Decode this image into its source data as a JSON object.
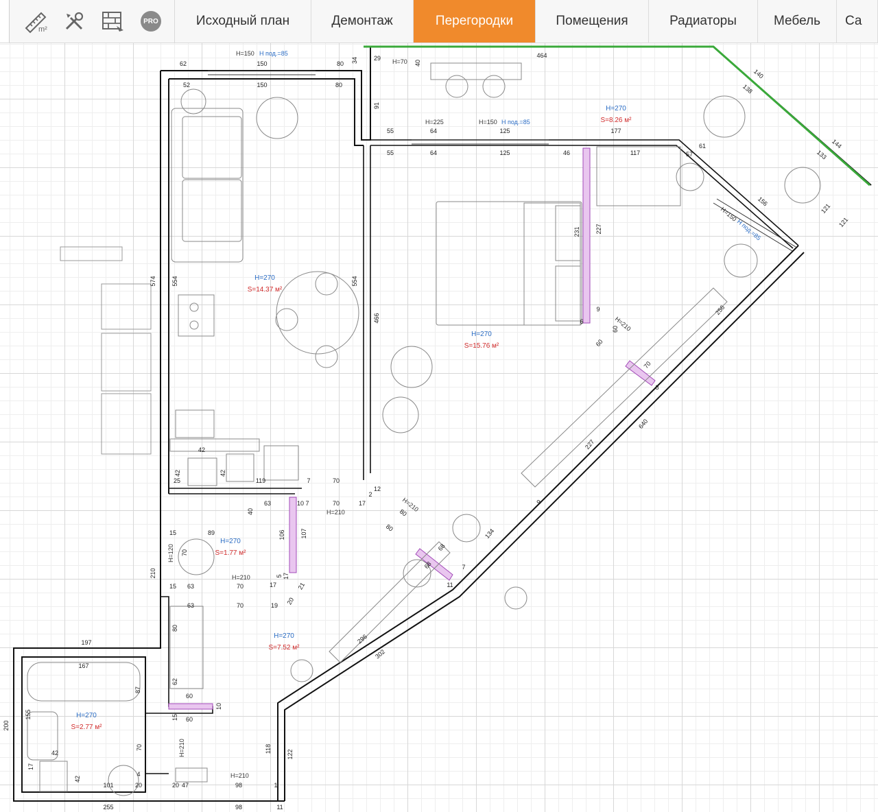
{
  "toolbar": {
    "icons": [
      "area-m2-icon",
      "tools-icon",
      "bricks-plan-icon",
      "pro-badge-icon"
    ],
    "pro_label": "PRO",
    "tabs": [
      {
        "label": "Исходный план",
        "active": false
      },
      {
        "label": "Демонтаж",
        "active": false
      },
      {
        "label": "Перегородки",
        "active": true
      },
      {
        "label": "Помещения",
        "active": false
      },
      {
        "label": "Радиаторы",
        "active": false
      },
      {
        "label": "Мебель",
        "active": false
      },
      {
        "label": "Са",
        "active": false
      }
    ],
    "accent_color": "#f08a2c"
  },
  "rooms": [
    {
      "height": "H=270",
      "area": "S=14.37 м²"
    },
    {
      "height": "H=270",
      "area": "S=15.76 м²"
    },
    {
      "height": "H=270",
      "area": "S=8.26 м²"
    },
    {
      "height": "H=270",
      "area": "S=1.77 м²"
    },
    {
      "height": "H=270",
      "area": "S=7.52 м²"
    },
    {
      "height": "H=270",
      "area": "S=2.77 м²"
    }
  ],
  "openings": {
    "window_top": "H=150",
    "sill_top": "Н под.=85",
    "h70": "H=70",
    "h225": "H=225",
    "window_mid": "H=150",
    "sill_mid": "Н под.=85",
    "window_diag": "H=150",
    "sill_diag": "Н под.=85",
    "door_h210": "H=210",
    "door_h120": "H=120"
  },
  "dimensions": {
    "top_a": "62",
    "top_b": "150",
    "top_c": "80",
    "top_d": "34",
    "in_a": "52",
    "in_b": "150",
    "in_c": "80",
    "balc_a": "29",
    "balc_b": "40",
    "balc_c": "464",
    "balc_d": "91",
    "balc_e": "55",
    "balc_f": "64",
    "balc_g": "125",
    "balc_h": "177",
    "bed_a": "55",
    "bed_b": "64",
    "bed_c": "125",
    "bed_d": "46",
    "bal2_a": "117",
    "bal2_b": "61",
    "bal2_c": "57",
    "bal2_d": "140",
    "bal2_e": "138",
    "bal2_f": "144",
    "bal2_g": "133",
    "bal2_h": "156",
    "bal2_i": "121",
    "bal2_j": "121",
    "left_574": "574",
    "k_554": "554",
    "k_554b": "554",
    "bed_466": "466",
    "bed_231": "231",
    "bed_227": "227",
    "d_256": "256",
    "k_42": "42",
    "k_42b": "42",
    "k_25": "25",
    "k_119": "119",
    "k_42c": "42",
    "c_70": "70",
    "c_7": "7",
    "c_2": "2",
    "c_12": "12",
    "c_17": "17",
    "c_70b": "70",
    "c_10": "10",
    "c_7b": "7",
    "c_40": "40",
    "c_63": "63",
    "c_106": "106",
    "c_107": "107",
    "c_15": "15",
    "c_89": "89",
    "c_70c": "70",
    "c_15b": "15",
    "c_63b": "63",
    "c_70d": "70",
    "c_17b": "17",
    "c_5": "5",
    "c_17c": "17",
    "c_21": "21",
    "c_20": "20",
    "c_19": "19",
    "c_70e": "70",
    "c_63c": "63",
    "c_80": "80",
    "c_62": "62",
    "c_60": "60",
    "c_10b": "10",
    "c_15c": "15",
    "c_60b": "60",
    "c_70f": "70",
    "d_80a": "80",
    "d_80b": "80",
    "d_68a": "68",
    "d_68b": "68",
    "d_7": "7",
    "d_11": "11",
    "d_134": "134",
    "d_9": "9",
    "d_227": "227",
    "d_640": "640",
    "d_296": "296",
    "d_302": "302",
    "d_6": "6",
    "d_9b": "9",
    "d_60": "60",
    "d_60b": "60",
    "d_70": "70",
    "d_8": "8",
    "w_197": "197",
    "w_210": "210",
    "w_200": "200",
    "b_167": "167",
    "b_87": "87",
    "b_155": "155",
    "b_42": "42",
    "b_17": "17",
    "b_42b": "42",
    "b_101": "101",
    "b_20": "20",
    "b_4": "4",
    "b_20b": "20",
    "b_47": "47",
    "b_98": "98",
    "b_1": "1",
    "b_98b": "98",
    "b_11": "11",
    "b_255": "255",
    "b_118": "118",
    "b_122": "122"
  }
}
